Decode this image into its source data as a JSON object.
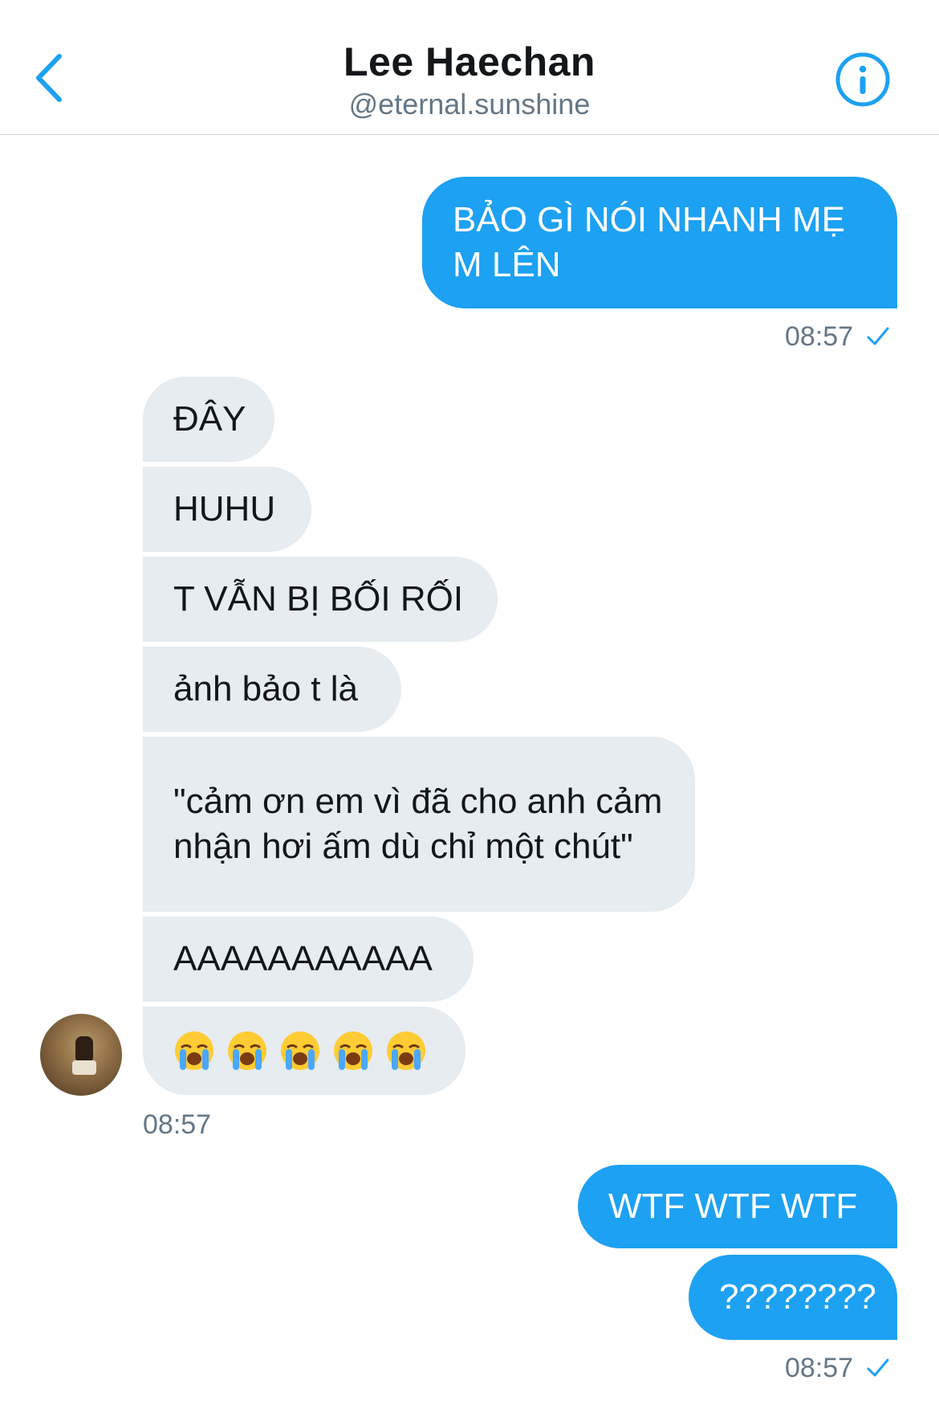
{
  "header": {
    "title": "Lee Haechan",
    "handle": "@eternal.sunshine"
  },
  "colors": {
    "accent": "#1da1f2",
    "received_bubble": "#e6ecf0",
    "meta_text": "#657786"
  },
  "messages": {
    "sent_1": {
      "text": "BẢO GÌ NÓI NHANH MẸ M LÊN",
      "time": "08:57"
    },
    "received": [
      {
        "text": "ĐÂY"
      },
      {
        "text": "HUHU"
      },
      {
        "text": "T VẪN BỊ BỐI RỐI"
      },
      {
        "text": "ảnh bảo t là"
      },
      {
        "text": "\"cảm ơn em vì đã cho anh cảm nhận hơi ấm dù chỉ một chút\""
      },
      {
        "text": "AAAAAAAAAAA"
      }
    ],
    "received_emoji": {
      "icon": "loudly-crying-face",
      "count": 5
    },
    "received_time": "08:57",
    "sent_2": {
      "text": "WTF WTF WTF"
    },
    "sent_3": {
      "text": "????????",
      "time": "08:57"
    }
  }
}
